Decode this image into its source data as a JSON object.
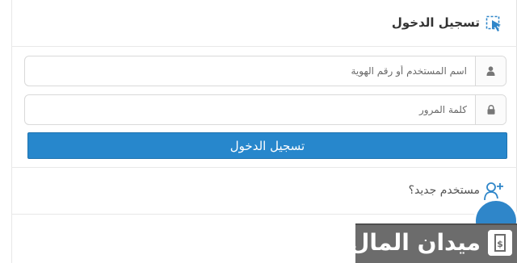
{
  "login": {
    "title": "تسجيل الدخول",
    "username_placeholder": "اسم المستخدم أو رقم الهوية",
    "password_placeholder": "كلمة المرور",
    "submit_label": "تسجيل الدخول"
  },
  "register": {
    "label": "مستخدم جديد؟"
  },
  "watermark": {
    "text": "ميدان المال"
  },
  "colors": {
    "primary": "#2787cc",
    "icon": "#2f86c9"
  },
  "icons": {
    "header": "login-cursor-icon",
    "username": "user-icon",
    "password": "lock-icon",
    "register": "add-user-icon",
    "chat": "chat-bubble-icon"
  }
}
